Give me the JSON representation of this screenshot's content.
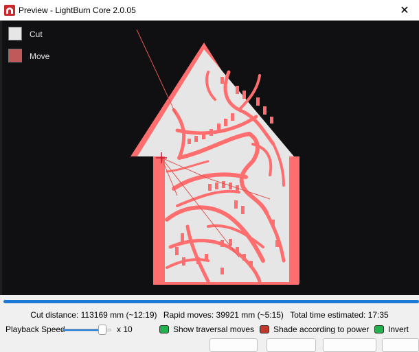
{
  "window": {
    "title": "Preview - LightBurn Core 2.0.05",
    "close_glyph": "✕",
    "app_icon": "lightburn-logo-icon",
    "accent_color": "#c9292b"
  },
  "legend": [
    {
      "label": "Cut",
      "color": "#e6e6e6"
    },
    {
      "label": "Move",
      "color": "#c05a5a"
    }
  ],
  "preview": {
    "background": "#101012",
    "cut_color": "#e6e6e6",
    "path_color": "#ff6e6e",
    "move_line_color": "#e15555",
    "cursor_icon": "crosshair-icon"
  },
  "playback": {
    "progress": 1.0,
    "speed_label": "Playback Speed",
    "speed_value": 0.82,
    "speed_multiplier": "x 10"
  },
  "stats": {
    "cut_distance": "Cut distance: 113169 mm (~12:19)",
    "rapid_moves": "Rapid moves: 39921 mm (~5:15)",
    "total_time": "Total time estimated: 17:35"
  },
  "options": {
    "show_traversal": {
      "label": "Show traversal moves",
      "checked": true,
      "color": "#22b14c"
    },
    "shade_power": {
      "label": "Shade according to power",
      "checked": false,
      "color": "#c0392b"
    },
    "invert": {
      "label": "Invert",
      "checked": true,
      "color": "#22b14c"
    }
  }
}
